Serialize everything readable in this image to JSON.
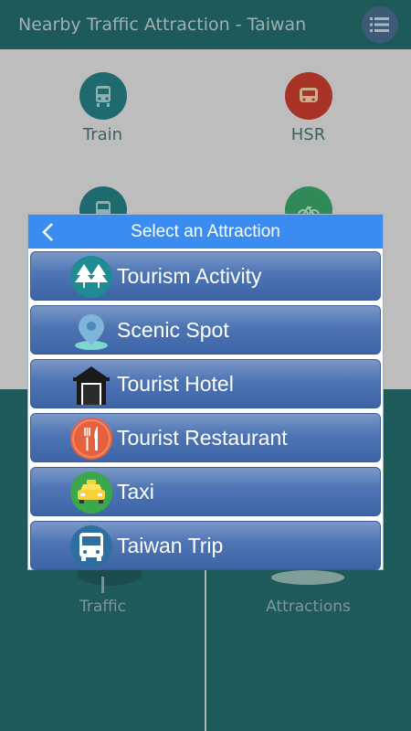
{
  "app": {
    "title": "Nearby Traffic Attraction - Taiwan",
    "menu_icon": "list-icon"
  },
  "grid": {
    "tiles": [
      {
        "label": "Train",
        "icon": "train-icon",
        "color": "#1f6a6e"
      },
      {
        "label": "HSR",
        "icon": "hsr-icon",
        "color": "#a83428"
      },
      {
        "label": "",
        "icon": "bus-icon",
        "color": "#1f6a6e"
      },
      {
        "label": "",
        "icon": "bike-icon",
        "color": "#2f8a58"
      }
    ]
  },
  "bottom": {
    "left_label": "Traffic",
    "right_label": "Attractions"
  },
  "dialog": {
    "title": "Select an Attraction",
    "back_icon": "chevron-left-icon",
    "items": [
      {
        "label": "Tourism Activity",
        "icon": "tree-icon"
      },
      {
        "label": "Scenic Spot",
        "icon": "location-pin-icon"
      },
      {
        "label": "Tourist Hotel",
        "icon": "hotel-icon"
      },
      {
        "label": "Tourist Restaurant",
        "icon": "fork-knife-icon"
      },
      {
        "label": "Taxi",
        "icon": "taxi-icon"
      },
      {
        "label": "Taiwan Trip",
        "icon": "bus-icon"
      }
    ]
  },
  "colors": {
    "appbar": "#1f5a5a",
    "dialog_header": "#3a8cf0",
    "item_button": "#4d74b3"
  }
}
